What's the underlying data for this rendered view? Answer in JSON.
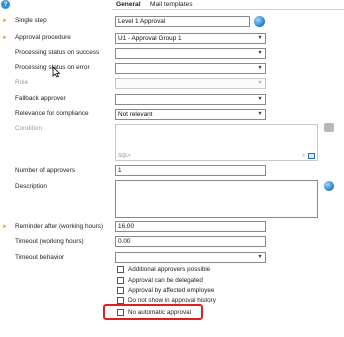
{
  "header": {
    "help_glyph": "?"
  },
  "tabs": [
    {
      "label": "General",
      "active": true
    },
    {
      "label": "Mail templates",
      "active": false
    }
  ],
  "fields": {
    "single_step": {
      "label": "Single step",
      "required": true,
      "value": "Level 1 Approval"
    },
    "approval_procedure": {
      "label": "Approval procedure",
      "required": true,
      "value": "U1 - Approval Group 1"
    },
    "processing_status_success": {
      "label": "Processing status on success",
      "value": ""
    },
    "processing_status_error": {
      "label": "Processing status on error",
      "value": ""
    },
    "role": {
      "label": "Role",
      "disabled": true,
      "value": ""
    },
    "fallback_approver": {
      "label": "Fallback approver",
      "value": ""
    },
    "relevance_compliance": {
      "label": "Relevance for compliance",
      "value": "Not relevant"
    },
    "condition": {
      "label": "Condition",
      "disabled": true,
      "value": "",
      "sql_label": "SQL"
    },
    "number_of_approvers": {
      "label": "Number of approvers",
      "value": "1"
    },
    "description": {
      "label": "Description",
      "value": ""
    },
    "reminder_after": {
      "label": "Reminder after (working hours)",
      "required": true,
      "value": "16.00"
    },
    "timeout": {
      "label": "Timeout (working hours)",
      "value": "0.00"
    },
    "timeout_behavior": {
      "label": "Timeout behavior",
      "value": ""
    }
  },
  "checkboxes": [
    {
      "label": "Additional approvers possible",
      "checked": false
    },
    {
      "label": "Approval can be delegated",
      "checked": false
    },
    {
      "label": "Approval by affected employee",
      "checked": false
    },
    {
      "label": "Do not show in approval history",
      "checked": false
    },
    {
      "label": "No automatic approval",
      "checked": false,
      "highlighted": true
    }
  ],
  "colors": {
    "required_star": "#f0a020",
    "highlight": "#e02020",
    "accent": "#2f8fd6"
  }
}
